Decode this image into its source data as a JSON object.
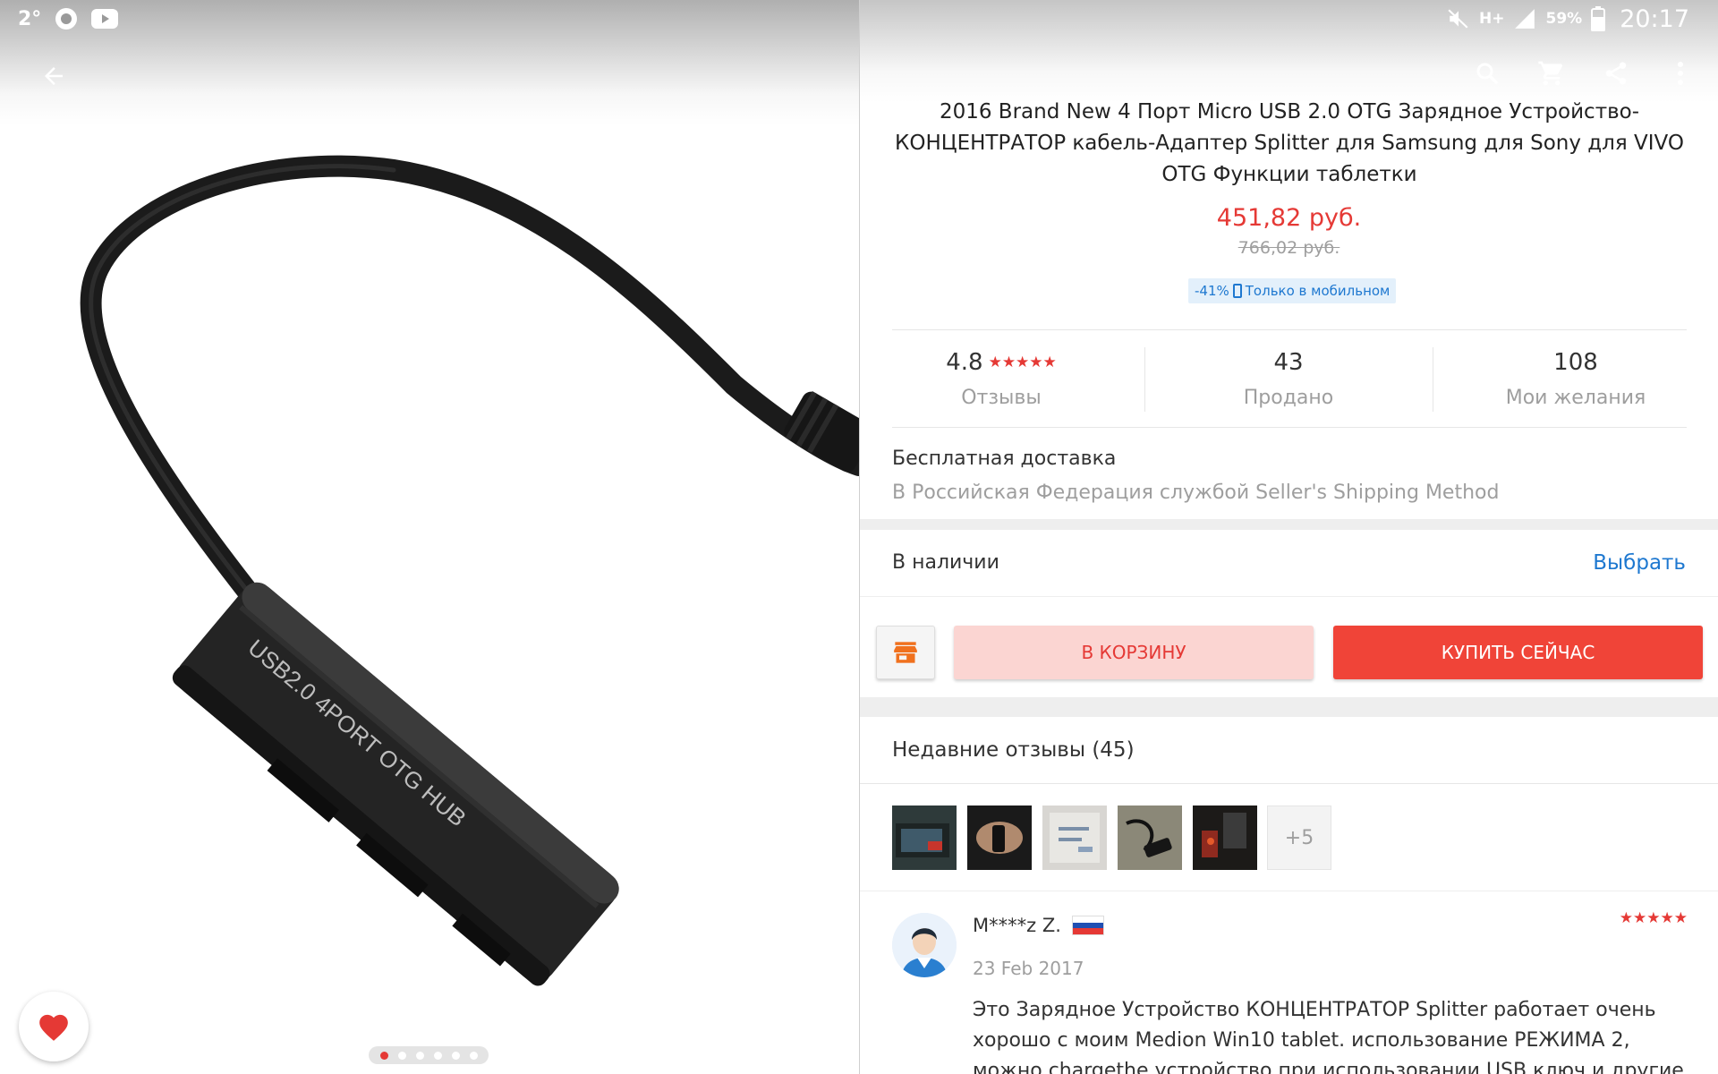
{
  "status_bar": {
    "temperature": "2°",
    "battery_percent": "59%",
    "network_type": "H+",
    "time": "20:17"
  },
  "gallery": {
    "product_print": "USB2.0 4PORT OTG HUB",
    "image_count": 6,
    "active_index": 0
  },
  "product": {
    "title": "2016 Brand New 4 Порт Micro USB 2.0 OTG Зарядное Устройство-КОНЦЕНТРАТОР кабель-Адаптер Splitter для Samsung для Sony для VIVO OTG Функции таблетки",
    "price": "451,82 руб.",
    "old_price": "766,02 руб.",
    "discount_percent": "-41%",
    "discount_note": "Только в мобильном"
  },
  "stats": {
    "rating": "4.8",
    "rating_stars": "★★★★★",
    "reviews_label": "Отзывы",
    "sold_count": "43",
    "sold_label": "Продано",
    "wishlist_count": "108",
    "wishlist_label": "Мои желания"
  },
  "shipping": {
    "title": "Бесплатная доставка",
    "description": "В Российская Федерация службой Seller's Shipping Method"
  },
  "stock": {
    "label": "В наличии",
    "select_label": "Выбрать"
  },
  "actions": {
    "cart_label": "В КОРЗИНУ",
    "buy_label": "КУПИТЬ СЕЙЧАС"
  },
  "reviews": {
    "title": "Недавние отзывы (45)",
    "more_photos": "+5",
    "first": {
      "author": "M****z Z.",
      "date": "23 Feb 2017",
      "stars": "★★★★★",
      "text": "Это Зарядное Устройство КОНЦЕНТРАТОР Splitter работает очень хорошо с моим Medion Win10 tablet. использование РЕЖИМА 2, можно chargethe устройство при использовании USB ключ и другие"
    }
  },
  "colors": {
    "accent_red": "#e53935",
    "link_blue": "#1e78d0",
    "cart_bg": "#fbd5d2",
    "buy_bg": "#f04438"
  },
  "icons": [
    "back-arrow-icon",
    "search-icon",
    "cart-icon",
    "share-icon",
    "more-vert-icon",
    "store-icon",
    "heart-icon",
    "weather-icon",
    "vpn-shield-icon",
    "youtube-icon",
    "mute-icon",
    "signal-icon",
    "battery-icon"
  ]
}
